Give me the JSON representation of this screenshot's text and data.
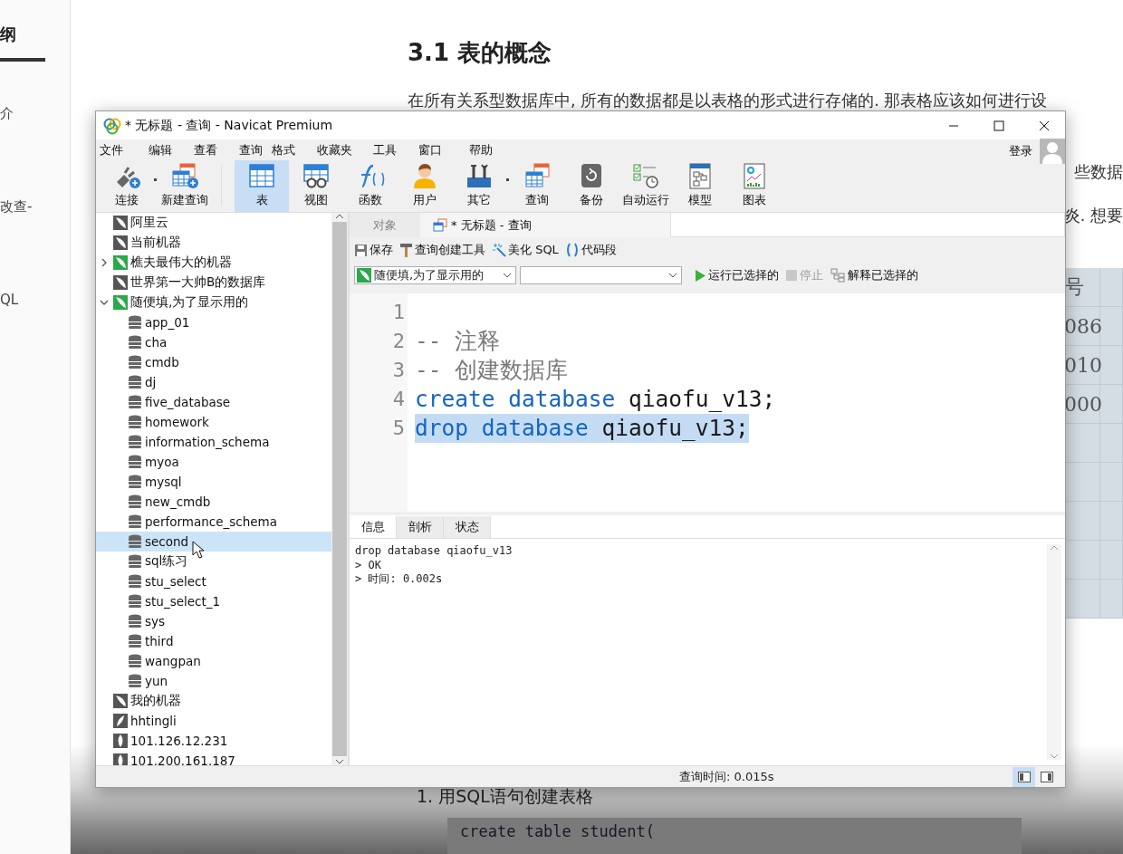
{
  "document": {
    "outline": {
      "title": "纲",
      "items": [
        "介",
        "改查-",
        "QL"
      ]
    },
    "heading": "3.1 表的概念",
    "paragraph": "在所有关系型数据库中, 所有的数据都是以表格的形式进行存储的. 那表格应该如何进行设",
    "fragments": [
      "些数据",
      "炎. 想要"
    ],
    "table_fragment": {
      "header": "号",
      "cells": [
        "086",
        "010",
        "000"
      ]
    },
    "step": "1. 用SQL语句创建表格",
    "code": "create table student("
  },
  "window": {
    "title": "* 无标题 - 查询 - Navicat Premium",
    "menu": [
      "文件",
      "编辑",
      "查看",
      "查询",
      "格式",
      "收藏夹",
      "工具",
      "窗口",
      "帮助"
    ],
    "account": {
      "label": "登录"
    },
    "toolbar": [
      {
        "kind": "connect",
        "label": "连接",
        "selected": false,
        "dropdown": true
      },
      {
        "kind": "new-query",
        "label": "新建查询",
        "selected": false,
        "dropdown": false
      },
      {
        "kind": "table",
        "label": "表",
        "selected": true,
        "dropdown": false
      },
      {
        "kind": "view",
        "label": "视图",
        "selected": false,
        "dropdown": false
      },
      {
        "kind": "function",
        "label": "函数",
        "selected": false,
        "dropdown": false
      },
      {
        "kind": "user",
        "label": "用户",
        "selected": false,
        "dropdown": false
      },
      {
        "kind": "other",
        "label": "其它",
        "selected": false,
        "dropdown": true
      },
      {
        "kind": "query",
        "label": "查询",
        "selected": false,
        "dropdown": false
      },
      {
        "kind": "backup",
        "label": "备份",
        "selected": false,
        "dropdown": false
      },
      {
        "kind": "autorun",
        "label": "自动运行",
        "selected": false,
        "dropdown": false
      },
      {
        "kind": "model",
        "label": "模型",
        "selected": false,
        "dropdown": false
      },
      {
        "kind": "chart",
        "label": "图表",
        "selected": false,
        "dropdown": false
      }
    ],
    "tree": [
      {
        "kind": "mysql",
        "label": "阿里云",
        "connected": false,
        "selected": false
      },
      {
        "kind": "mysql",
        "label": "当前机器",
        "connected": false,
        "selected": false
      },
      {
        "kind": "mysql",
        "label": "樵夫最伟大的机器",
        "connected": true,
        "expanded": false,
        "selected": false
      },
      {
        "kind": "mysql",
        "label": "世界第一大帅B的数据库",
        "connected": false,
        "selected": false
      },
      {
        "kind": "mysql",
        "label": "随便填,为了显示用的",
        "connected": true,
        "expanded": true,
        "selected": false,
        "children": [
          {
            "kind": "database",
            "label": "app_01",
            "selected": false
          },
          {
            "kind": "database",
            "label": "cha",
            "selected": false
          },
          {
            "kind": "database",
            "label": "cmdb",
            "selected": false
          },
          {
            "kind": "database",
            "label": "dj",
            "selected": false
          },
          {
            "kind": "database",
            "label": "five_database",
            "selected": false
          },
          {
            "kind": "database",
            "label": "homework",
            "selected": false
          },
          {
            "kind": "database",
            "label": "information_schema",
            "selected": false
          },
          {
            "kind": "database",
            "label": "myoa",
            "selected": false
          },
          {
            "kind": "database",
            "label": "mysql",
            "selected": false
          },
          {
            "kind": "database",
            "label": "new_cmdb",
            "selected": false
          },
          {
            "kind": "database",
            "label": "performance_schema",
            "selected": false
          },
          {
            "kind": "database",
            "label": "second",
            "selected": true
          },
          {
            "kind": "database",
            "label": "sql练习",
            "selected": false
          },
          {
            "kind": "database",
            "label": "stu_select",
            "selected": false
          },
          {
            "kind": "database",
            "label": "stu_select_1",
            "selected": false
          },
          {
            "kind": "database",
            "label": "sys",
            "selected": false
          },
          {
            "kind": "database",
            "label": "third",
            "selected": false
          },
          {
            "kind": "database",
            "label": "wangpan",
            "selected": false
          },
          {
            "kind": "database",
            "label": "yun",
            "selected": false
          }
        ]
      },
      {
        "kind": "mysql",
        "label": "我的机器",
        "connected": false,
        "selected": false
      },
      {
        "kind": "feather",
        "label": "hhtingli",
        "selected": false
      },
      {
        "kind": "leaf",
        "label": "101.126.12.231",
        "selected": false
      },
      {
        "kind": "leaf",
        "label": "101.200.161.187",
        "selected": false
      }
    ],
    "tabs": [
      {
        "kind": "objects",
        "label": "对象",
        "selected": false
      },
      {
        "kind": "query",
        "label": "* 无标题 - 查询",
        "selected": true
      }
    ],
    "query_toolbar": [
      {
        "kind": "save",
        "label": "保存"
      },
      {
        "kind": "builder",
        "label": "查询创建工具"
      },
      {
        "kind": "beautify",
        "label": "美化 SQL"
      },
      {
        "kind": "snippet",
        "label": "代码段"
      }
    ],
    "connection_select": {
      "value": "随便填,为了显示用的"
    },
    "run_actions": [
      {
        "kind": "run",
        "label": "运行已选择的",
        "disabled": false
      },
      {
        "kind": "stop",
        "label": "停止",
        "disabled": true
      },
      {
        "kind": "explain",
        "label": "解释已选择的",
        "disabled": false
      }
    ],
    "editor": {
      "lines": [
        {
          "number": "1"
        },
        {
          "number": "2",
          "tokens": [
            {
              "kind": "comment",
              "text": "-- 注释"
            }
          ]
        },
        {
          "number": "3",
          "tokens": [
            {
              "kind": "comment",
              "text": "-- 创建数据库"
            }
          ]
        },
        {
          "number": "4",
          "tokens": [
            {
              "kind": "keyword",
              "text": "create database"
            },
            {
              "kind": "plain",
              "text": " qiaofu_v13;"
            }
          ]
        },
        {
          "number": "5",
          "selected": true,
          "tokens": [
            {
              "kind": "keyword",
              "text": "drop database"
            },
            {
              "kind": "plain",
              "text": " qiaofu_v13;"
            }
          ]
        }
      ]
    },
    "result_tabs": [
      {
        "label": "信息",
        "selected": true
      },
      {
        "label": "剖析",
        "selected": false
      },
      {
        "label": "状态",
        "selected": false
      }
    ],
    "output": [
      "drop database qiaofu_v13",
      "> OK",
      "> 时间: 0.002s"
    ],
    "status": "查询时间: 0.015s",
    "view_toggles": [
      {
        "kind": "left-pane",
        "selected": true
      },
      {
        "kind": "right-pane",
        "selected": false
      }
    ]
  }
}
